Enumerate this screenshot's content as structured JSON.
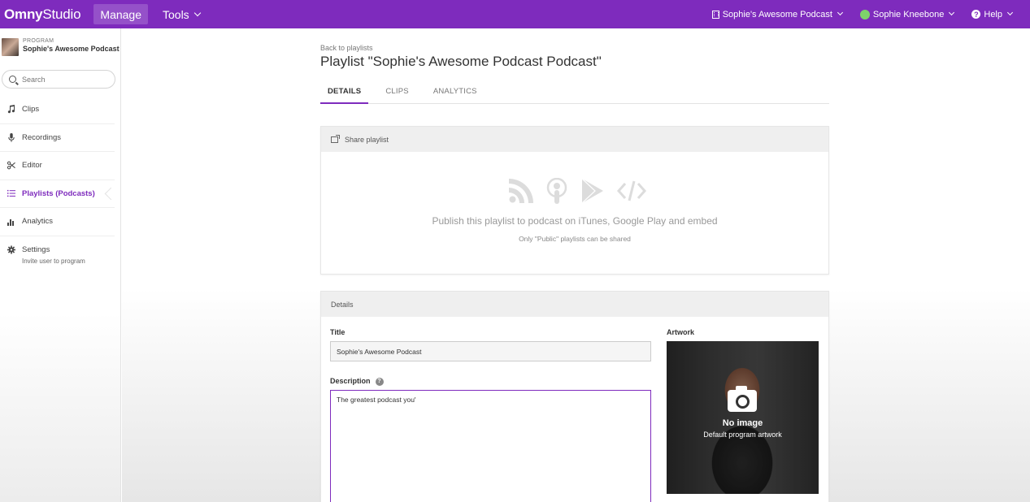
{
  "topbar": {
    "logo_brand": "Omny",
    "logo_product": "Studio",
    "manage": "Manage",
    "tools": "Tools",
    "org": "Sophie's Awesome Podcast",
    "user": "Sophie Kneebone",
    "help": "Help",
    "bg_color": "#7e2bbd",
    "user_color": "#7ed36b"
  },
  "sidebar": {
    "program_label": "PROGRAM",
    "program_name": "Sophie's Awesome Podcast",
    "search_placeholder": "Search",
    "items": [
      {
        "label": "Clips",
        "icon": "music-note-icon"
      },
      {
        "label": "Recordings",
        "icon": "microphone-icon"
      },
      {
        "label": "Editor",
        "icon": "scissors-icon"
      },
      {
        "label": "Playlists (Podcasts)",
        "icon": "list-icon"
      },
      {
        "label": "Analytics",
        "icon": "bar-chart-icon"
      },
      {
        "label": "Settings",
        "icon": "gear-icon"
      }
    ],
    "invite": "Invite user to program"
  },
  "main": {
    "back": "Back to playlists",
    "title": "Playlist \"Sophie's Awesome Podcast Podcast\"",
    "tabs": [
      "DETAILS",
      "CLIPS",
      "ANALYTICS"
    ],
    "share": {
      "header": "Share playlist",
      "icons": [
        "rss-icon",
        "podcast-icon",
        "google-play-icon",
        "embed-code-icon"
      ],
      "publish_text": "Publish this playlist to podcast on iTunes, Google Play and embed",
      "note": "Only \"Public\" playlists can be shared"
    },
    "details": {
      "header": "Details",
      "title_label": "Title",
      "title_value": "Sophie's Awesome Podcast",
      "description_label": "Description",
      "description_value": "The greatest podcast you'",
      "artwork_label": "Artwork",
      "no_image": "No image",
      "default_artwork": "Default program artwork"
    }
  }
}
